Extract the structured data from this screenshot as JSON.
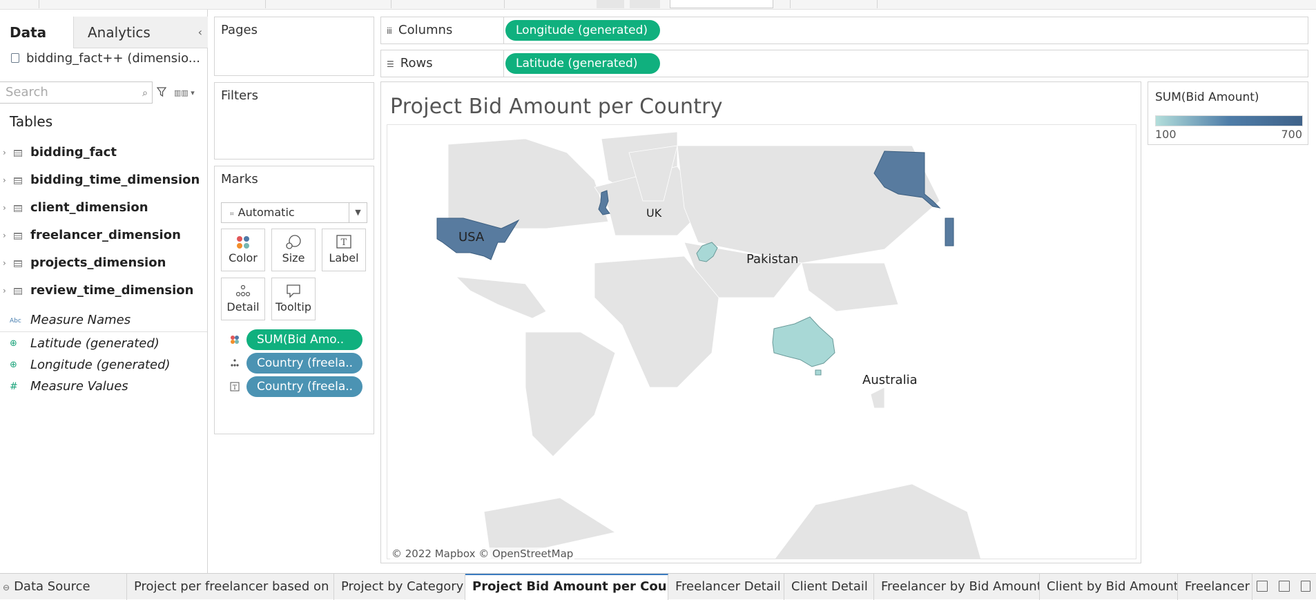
{
  "data_pane": {
    "tab_data": "Data",
    "tab_analytics": "Analytics",
    "collapse_icon": "chevron-left-icon",
    "datasource": "bidding_fact++ (dimensio...",
    "search_placeholder": "Search",
    "tables_heading": "Tables",
    "tables": [
      {
        "label": "bidding_fact"
      },
      {
        "label": "bidding_time_dimension"
      },
      {
        "label": "client_dimension"
      },
      {
        "label": "freelancer_dimension"
      },
      {
        "label": "projects_dimension"
      },
      {
        "label": "review_time_dimension"
      }
    ],
    "fields": [
      {
        "label": "Measure Names",
        "icon": "Abc"
      },
      {
        "label": "Latitude (generated)",
        "icon": "globe-icon"
      },
      {
        "label": "Longitude (generated)",
        "icon": "globe-icon"
      },
      {
        "label": "Measure Values",
        "icon": "#"
      }
    ]
  },
  "pages_card": {
    "title": "Pages"
  },
  "filters_card": {
    "title": "Filters"
  },
  "marks_card": {
    "title": "Marks",
    "mark_type": "Automatic",
    "buttons": {
      "color": "Color",
      "size": "Size",
      "label": "Label",
      "detail": "Detail",
      "tooltip": "Tooltip"
    },
    "pills": [
      {
        "label": "SUM(Bid Amo..",
        "encoding": "color"
      },
      {
        "label": "Country (freela..",
        "encoding": "detail"
      },
      {
        "label": "Country (freela..",
        "encoding": "label"
      }
    ]
  },
  "shelves": {
    "columns_label": "Columns",
    "columns_pill": "Longitude (generated)",
    "rows_label": "Rows",
    "rows_pill": "Latitude (generated)"
  },
  "view": {
    "title": "Project Bid Amount per Country",
    "copyright": "© 2022 Mapbox © OpenStreetMap",
    "country_labels": {
      "usa": "USA",
      "uk": "UK",
      "pakistan": "Pakistan",
      "australia": "Australia"
    }
  },
  "legend": {
    "title": "SUM(Bid Amount)",
    "min": "100",
    "max": "700"
  },
  "sheet_tabs": [
    {
      "label": "Data Source"
    },
    {
      "label": "Project per freelancer based on ..."
    },
    {
      "label": "Project by Category"
    },
    {
      "label": "Project Bid Amount per Country"
    },
    {
      "label": "Freelancer Detail"
    },
    {
      "label": "Client Detail"
    },
    {
      "label": "Freelancer by Bid Amount"
    },
    {
      "label": "Client by Bid Amount"
    },
    {
      "label": "Freelancer l"
    }
  ],
  "colors": {
    "pill_green": "#10b07e",
    "pill_blue": "#4b93b3",
    "map_dark": "#587b9f",
    "map_light": "#a8d8d6"
  }
}
